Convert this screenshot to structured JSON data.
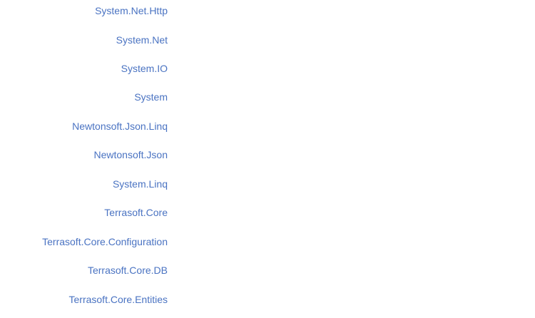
{
  "namespaces": [
    {
      "label": "System.Net.Http"
    },
    {
      "label": "System.Net"
    },
    {
      "label": "System.IO"
    },
    {
      "label": "System"
    },
    {
      "label": "Newtonsoft.Json.Linq"
    },
    {
      "label": "Newtonsoft.Json"
    },
    {
      "label": "System.Linq"
    },
    {
      "label": "Terrasoft.Core"
    },
    {
      "label": "Terrasoft.Core.Configuration"
    },
    {
      "label": "Terrasoft.Core.DB"
    },
    {
      "label": "Terrasoft.Core.Entities"
    }
  ],
  "colors": {
    "link": "#4a73c2",
    "background": "#ffffff"
  }
}
